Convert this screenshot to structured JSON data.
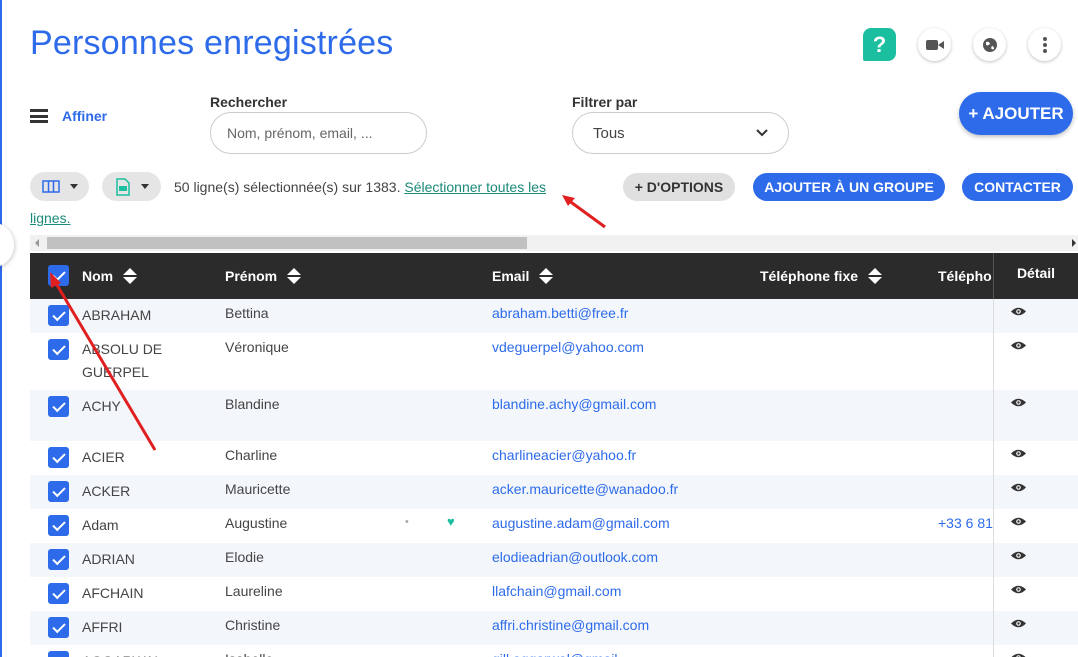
{
  "page": {
    "title": "Personnes enregistrées",
    "help_label": "?"
  },
  "toolbar": {
    "affiner_label": "Affiner",
    "search_label": "Rechercher",
    "search_placeholder": "Nom, prénom, email, ...",
    "filter_label": "Filtrer par",
    "filter_value": "Tous",
    "add_label": "+ AJOUTER"
  },
  "selection": {
    "text": "50 ligne(s) sélectionnée(s) sur 1383.",
    "link_part1": "Sélectionner toutes les",
    "link_part2": "lignes.",
    "options_label": "+ D'OPTIONS",
    "group_label": "AJOUTER À UN GROUPE",
    "contact_label": "CONTACTER"
  },
  "table": {
    "headers": {
      "nom": "Nom",
      "prenom": "Prénom",
      "email": "Email",
      "tel_fixe": "Téléphone fixe",
      "tel_mobile": "Télépho",
      "detail": "Détail"
    },
    "rows": [
      {
        "nom": "ABRAHAM",
        "prenom": "Bettina",
        "email": "abraham.betti@free.fr",
        "mobile": "",
        "height": 34
      },
      {
        "nom": "ABSOLU DE GUERPEL",
        "prenom": "Véronique",
        "email": "vdeguerpel@yahoo.com",
        "mobile": "",
        "height": 57
      },
      {
        "nom": "ACHY",
        "prenom": "Blandine",
        "email": "blandine.achy@gmail.com",
        "mobile": "",
        "height": 51
      },
      {
        "nom": "ACIER",
        "prenom": "Charline",
        "email": "charlineacier@yahoo.fr",
        "mobile": "",
        "height": 34
      },
      {
        "nom": "ACKER",
        "prenom": "Mauricette",
        "email": "acker.mauricette@wanadoo.fr",
        "mobile": "",
        "height": 34
      },
      {
        "nom": "Adam",
        "prenom": "Augustine",
        "email": "augustine.adam@gmail.com",
        "mobile": "+33 6 81",
        "height": 34
      },
      {
        "nom": "ADRIAN",
        "prenom": "Elodie",
        "email": "elodieadrian@outlook.com",
        "mobile": "",
        "height": 34
      },
      {
        "nom": "AFCHAIN",
        "prenom": "Laureline",
        "email": "llafchain@gmail.com",
        "mobile": "",
        "height": 34
      },
      {
        "nom": "AFFRI",
        "prenom": "Christine",
        "email": "affri.christine@gmail.com",
        "mobile": "",
        "height": 34
      },
      {
        "nom": "AGGARWAL",
        "prenom": "Isabelle",
        "email": "gill.aggarwal@gmail",
        "mobile": "",
        "height": 34
      }
    ]
  },
  "colors": {
    "accent": "#2d6bea",
    "teal": "#1bbfa0",
    "header_bg": "#2b2b2b",
    "annotation": "#e02020"
  }
}
